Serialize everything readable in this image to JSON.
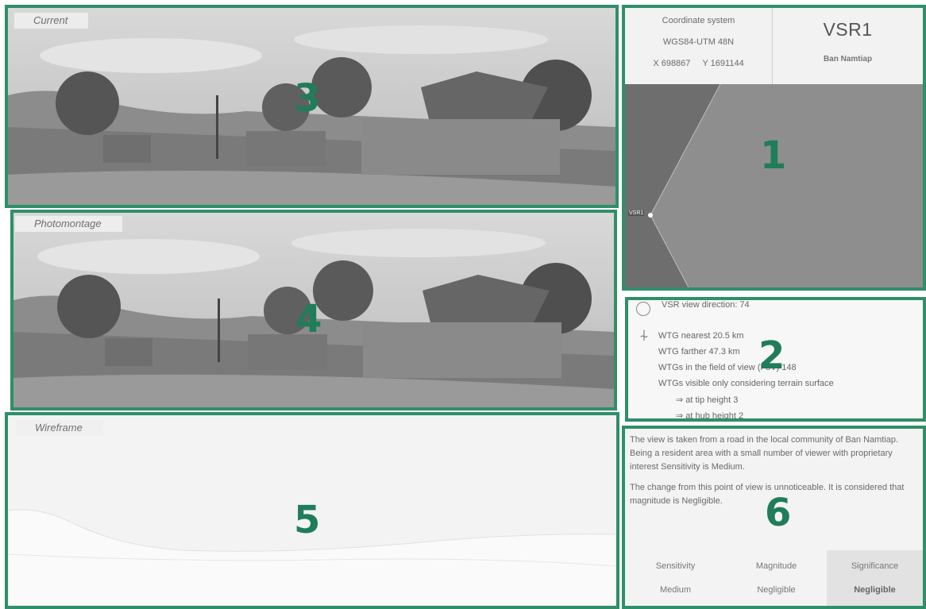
{
  "panels": {
    "current": {
      "label": "Current",
      "number": "3"
    },
    "photomontage": {
      "label": "Photomontage",
      "number": "4"
    },
    "wireframe": {
      "label": "Wireframe",
      "number": "5"
    },
    "map": {
      "number": "1"
    },
    "stats": {
      "number": "2"
    },
    "assessment": {
      "number": "6"
    }
  },
  "coordinates": {
    "title": "Coordinate system",
    "system": "WGS84-UTM 48N",
    "x": "X  698867",
    "y": "Y  1691144"
  },
  "viewpoint": {
    "id": "VSR1",
    "name": "Ban Namtiap",
    "map_tag": "VSR1"
  },
  "stats": {
    "view_direction": "VSR view direction: 74",
    "nearest": "WTG nearest   20.5 km",
    "farther": "WTG farther   47.3 km",
    "fov": "WTGs in the field of view (FoV)   148",
    "visible_terrain": "WTGs visible only considering terrain surface",
    "tip": "⇒  at tip height   3",
    "hub": "⇒  at hub height   2"
  },
  "assessment": {
    "paragraph1": "The view is taken from a road in the local community of Ban Namtiap. Being a resident area with a small number of viewer with proprietary interest Sensitivity is Medium.",
    "paragraph2": "The change from this point of view is unnoticeable. It is considered that magnitude is Negligible.",
    "headers": [
      "Sensitivity",
      "Magnitude",
      "Significance"
    ],
    "values": [
      "Medium",
      "Negligible",
      "Negligible"
    ]
  },
  "colors": {
    "frame": "#2f8f68",
    "number": "#1f7d5a"
  },
  "icons": [
    "compass-icon",
    "wind-turbine-icon"
  ]
}
